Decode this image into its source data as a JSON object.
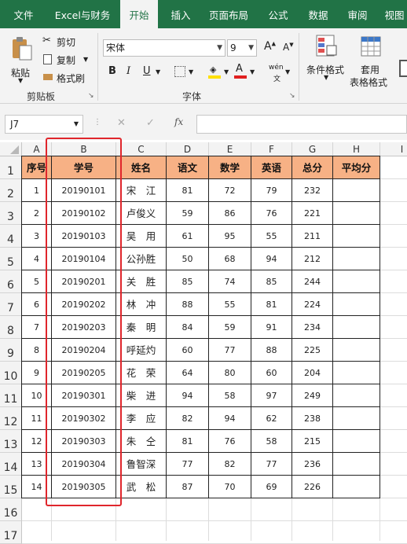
{
  "tabs": [
    "文件",
    "Excel与财务",
    "开始",
    "插入",
    "页面布局",
    "公式",
    "数据",
    "审阅",
    "视图"
  ],
  "ribbon": {
    "clipboard": {
      "paste": "粘贴",
      "cut": "剪切",
      "copy": "复制",
      "format_painter": "格式刷",
      "group": "剪贴板"
    },
    "font": {
      "name": "宋体",
      "size": "9",
      "grow": "A",
      "shrink": "A",
      "bold": "B",
      "italic": "I",
      "underline": "U",
      "phonetic": "wén",
      "group": "字体"
    },
    "styles": {
      "conditional": "条件格式",
      "table1": "套用",
      "table2": "表格格式"
    }
  },
  "formula_bar": {
    "name_box": "J7",
    "cancel": "✕",
    "enter": "✓",
    "fx": "fx",
    "value": ""
  },
  "columns": [
    "A",
    "B",
    "C",
    "D",
    "E",
    "F",
    "G",
    "H",
    "I"
  ],
  "rows": [
    "1",
    "2",
    "3",
    "4",
    "5",
    "6",
    "7",
    "8",
    "9",
    "10",
    "11",
    "12",
    "13",
    "14",
    "15",
    "16",
    "17"
  ],
  "table": {
    "headers": [
      "序号",
      "学号",
      "姓名",
      "语文",
      "数学",
      "英语",
      "总分",
      "平均分"
    ],
    "data": [
      [
        "1",
        "20190101",
        "宋　江",
        "81",
        "72",
        "79",
        "232",
        ""
      ],
      [
        "2",
        "20190102",
        "卢俊义",
        "59",
        "86",
        "76",
        "221",
        ""
      ],
      [
        "3",
        "20190103",
        "吴　用",
        "61",
        "95",
        "55",
        "211",
        ""
      ],
      [
        "4",
        "20190104",
        "公孙胜",
        "50",
        "68",
        "94",
        "212",
        ""
      ],
      [
        "5",
        "20190201",
        "关　胜",
        "85",
        "74",
        "85",
        "244",
        ""
      ],
      [
        "6",
        "20190202",
        "林　冲",
        "88",
        "55",
        "81",
        "224",
        ""
      ],
      [
        "7",
        "20190203",
        "秦　明",
        "84",
        "59",
        "91",
        "234",
        ""
      ],
      [
        "8",
        "20190204",
        "呼延灼",
        "60",
        "77",
        "88",
        "225",
        ""
      ],
      [
        "9",
        "20190205",
        "花　荣",
        "64",
        "80",
        "60",
        "204",
        ""
      ],
      [
        "10",
        "20190301",
        "柴　进",
        "94",
        "58",
        "97",
        "249",
        ""
      ],
      [
        "11",
        "20190302",
        "李　应",
        "82",
        "94",
        "62",
        "238",
        ""
      ],
      [
        "12",
        "20190303",
        "朱　仝",
        "81",
        "76",
        "58",
        "215",
        ""
      ],
      [
        "13",
        "20190304",
        "鲁智深",
        "77",
        "82",
        "77",
        "236",
        ""
      ],
      [
        "14",
        "20190305",
        "武　松",
        "87",
        "70",
        "69",
        "226",
        ""
      ]
    ]
  },
  "colors": {
    "brand": "#217346",
    "header_fill": "#f7b185",
    "highlight_box": "#e0262c"
  }
}
